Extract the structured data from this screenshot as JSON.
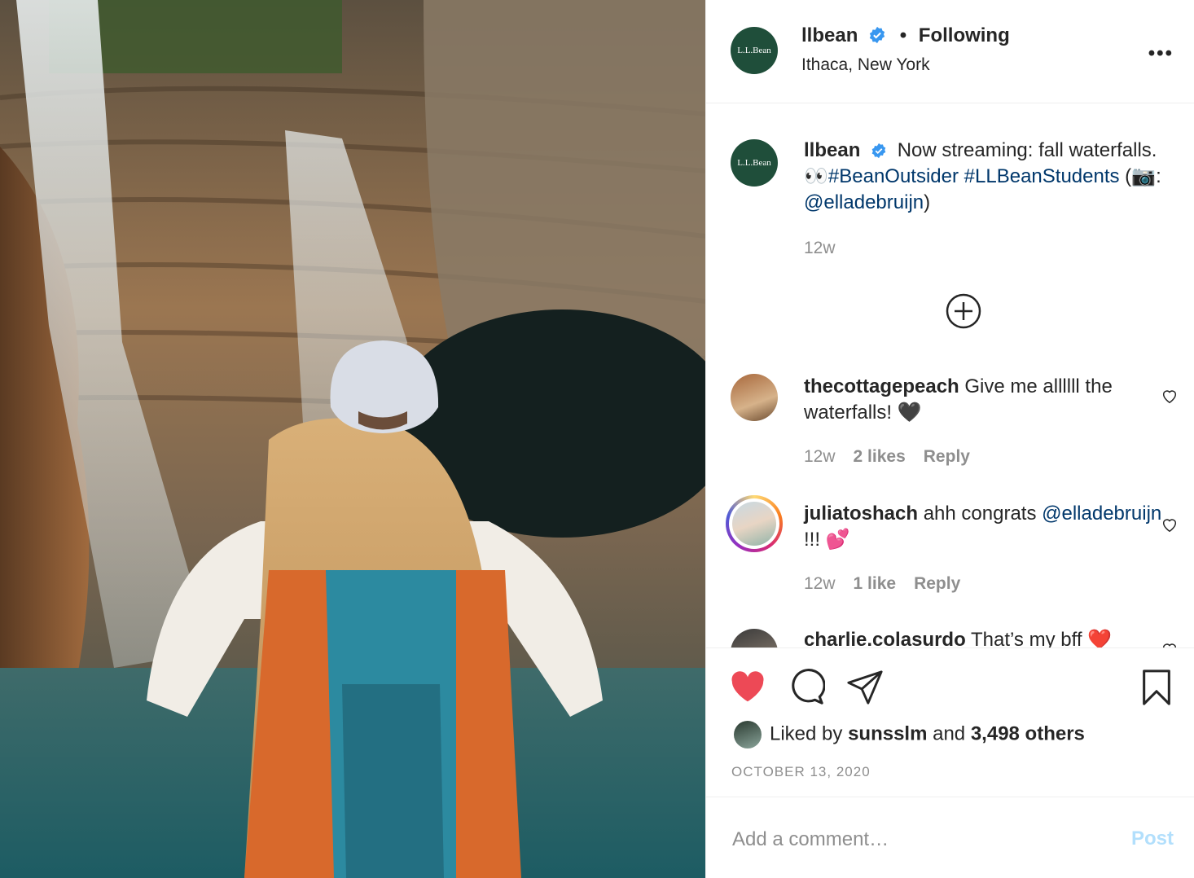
{
  "post": {
    "author": "llbean",
    "follow_state": "Following",
    "location": "Ithaca, New York",
    "logo_text": "L.L.Bean",
    "more_icon": "more-horizontal-icon",
    "verified_color": "#3897f0"
  },
  "caption": {
    "author": "llbean",
    "text_part1": "Now streaming: fall waterfalls. ",
    "eyes_emoji": "👀",
    "hashtag1": "#BeanOutsider",
    "hashtag2": "#LLBeanStudents",
    "paren_open": " (",
    "camera_emoji": "📷",
    "colon": ": ",
    "mention": "@elladebruijn",
    "paren_close": ")",
    "age": "12w"
  },
  "comments": [
    {
      "author": "thecottagepeach",
      "text": "Give me allllll the waterfalls! ",
      "emoji": "🖤",
      "age": "12w",
      "likes": "2 likes",
      "reply": "Reply"
    },
    {
      "author": "juliatoshach",
      "text": "ahh congrats",
      "mention": "@elladebruijn",
      "text2": " !!! ",
      "emoji": "💕",
      "age": "12w",
      "likes": "1 like",
      "reply": "Reply"
    },
    {
      "author": "charlie.colasurdo",
      "text": "That’s my bff ",
      "emoji": "❤️"
    }
  ],
  "actions": {
    "liked_prefix": "Liked by ",
    "liked_user": "sunsslm",
    "liked_and": " and ",
    "liked_others": "3,498 others",
    "date": "OCTOBER 13, 2020",
    "heart_color": "#ed4956"
  },
  "add_comment": {
    "placeholder": "Add a comment…",
    "post_label": "Post",
    "post_color": "#b2dffc"
  }
}
